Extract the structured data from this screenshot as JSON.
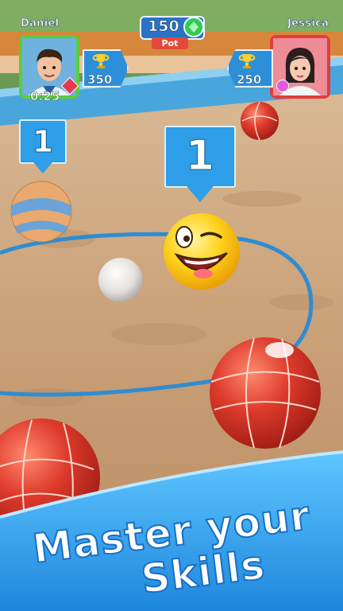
{
  "players": {
    "left": {
      "name": "Daniel",
      "score": "350",
      "timer": "0:25",
      "frame_color": "#5ccc3a"
    },
    "right": {
      "name": "Jessica",
      "score": "250",
      "frame_color": "#e23c3c"
    }
  },
  "pot": {
    "amount": "150",
    "label": "Pot",
    "icon": "green-gem-icon"
  },
  "markers": {
    "left_count": "1",
    "center_count": "1"
  },
  "headline": {
    "line1": "Master your",
    "line2": "Skills"
  },
  "colors": {
    "accent_blue": "#2e9ee8",
    "ball_red": "#d8362a",
    "sand": "#c9a57e"
  }
}
